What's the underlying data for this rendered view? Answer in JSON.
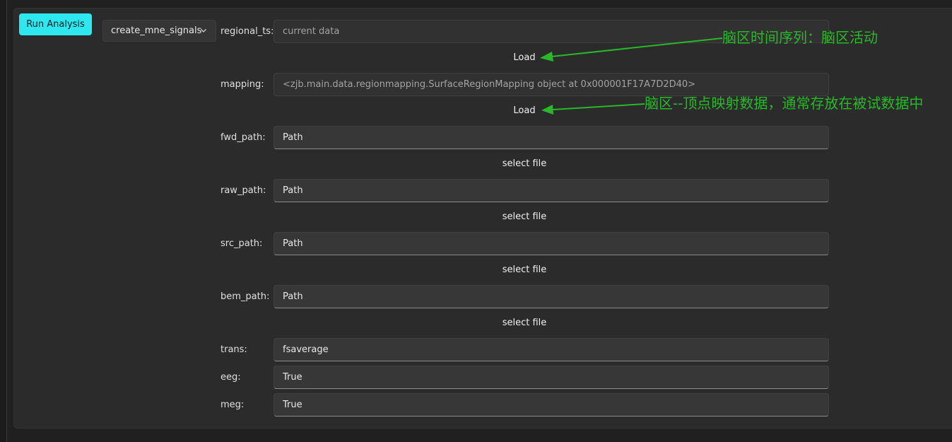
{
  "toolbar": {
    "run_label": "Run Analysis",
    "function_select": "create_mne_signals",
    "function_select_icon": "chevron-down-icon"
  },
  "form": {
    "regional_ts": {
      "label": "regional_ts:",
      "value": "current data",
      "action": "Load"
    },
    "mapping": {
      "label": "mapping:",
      "value": "<zjb.main.data.regionmapping.SurfaceRegionMapping object at 0x000001F17A7D2D40>",
      "action": "Load"
    },
    "fwd_path": {
      "label": "fwd_path:",
      "value": "Path",
      "action": "select file"
    },
    "raw_path": {
      "label": "raw_path:",
      "value": "Path",
      "action": "select file"
    },
    "src_path": {
      "label": "src_path:",
      "value": "Path",
      "action": "select file"
    },
    "bem_path": {
      "label": "bem_path:",
      "value": "Path",
      "action": "select file"
    },
    "trans": {
      "label": "trans:",
      "value": "fsaverage"
    },
    "eeg": {
      "label": "eeg:",
      "value": "True"
    },
    "meg": {
      "label": "meg:",
      "value": "True"
    }
  },
  "annotations": {
    "regional_ts_note": "脑区时间序列：脑区活动",
    "mapping_note": "脑区--顶点映射数据，通常存放在被试数据中",
    "color": "#28b828"
  },
  "colors": {
    "accent": "#2ee8f0",
    "background": "#202020",
    "panel": "#2b2b2b"
  }
}
